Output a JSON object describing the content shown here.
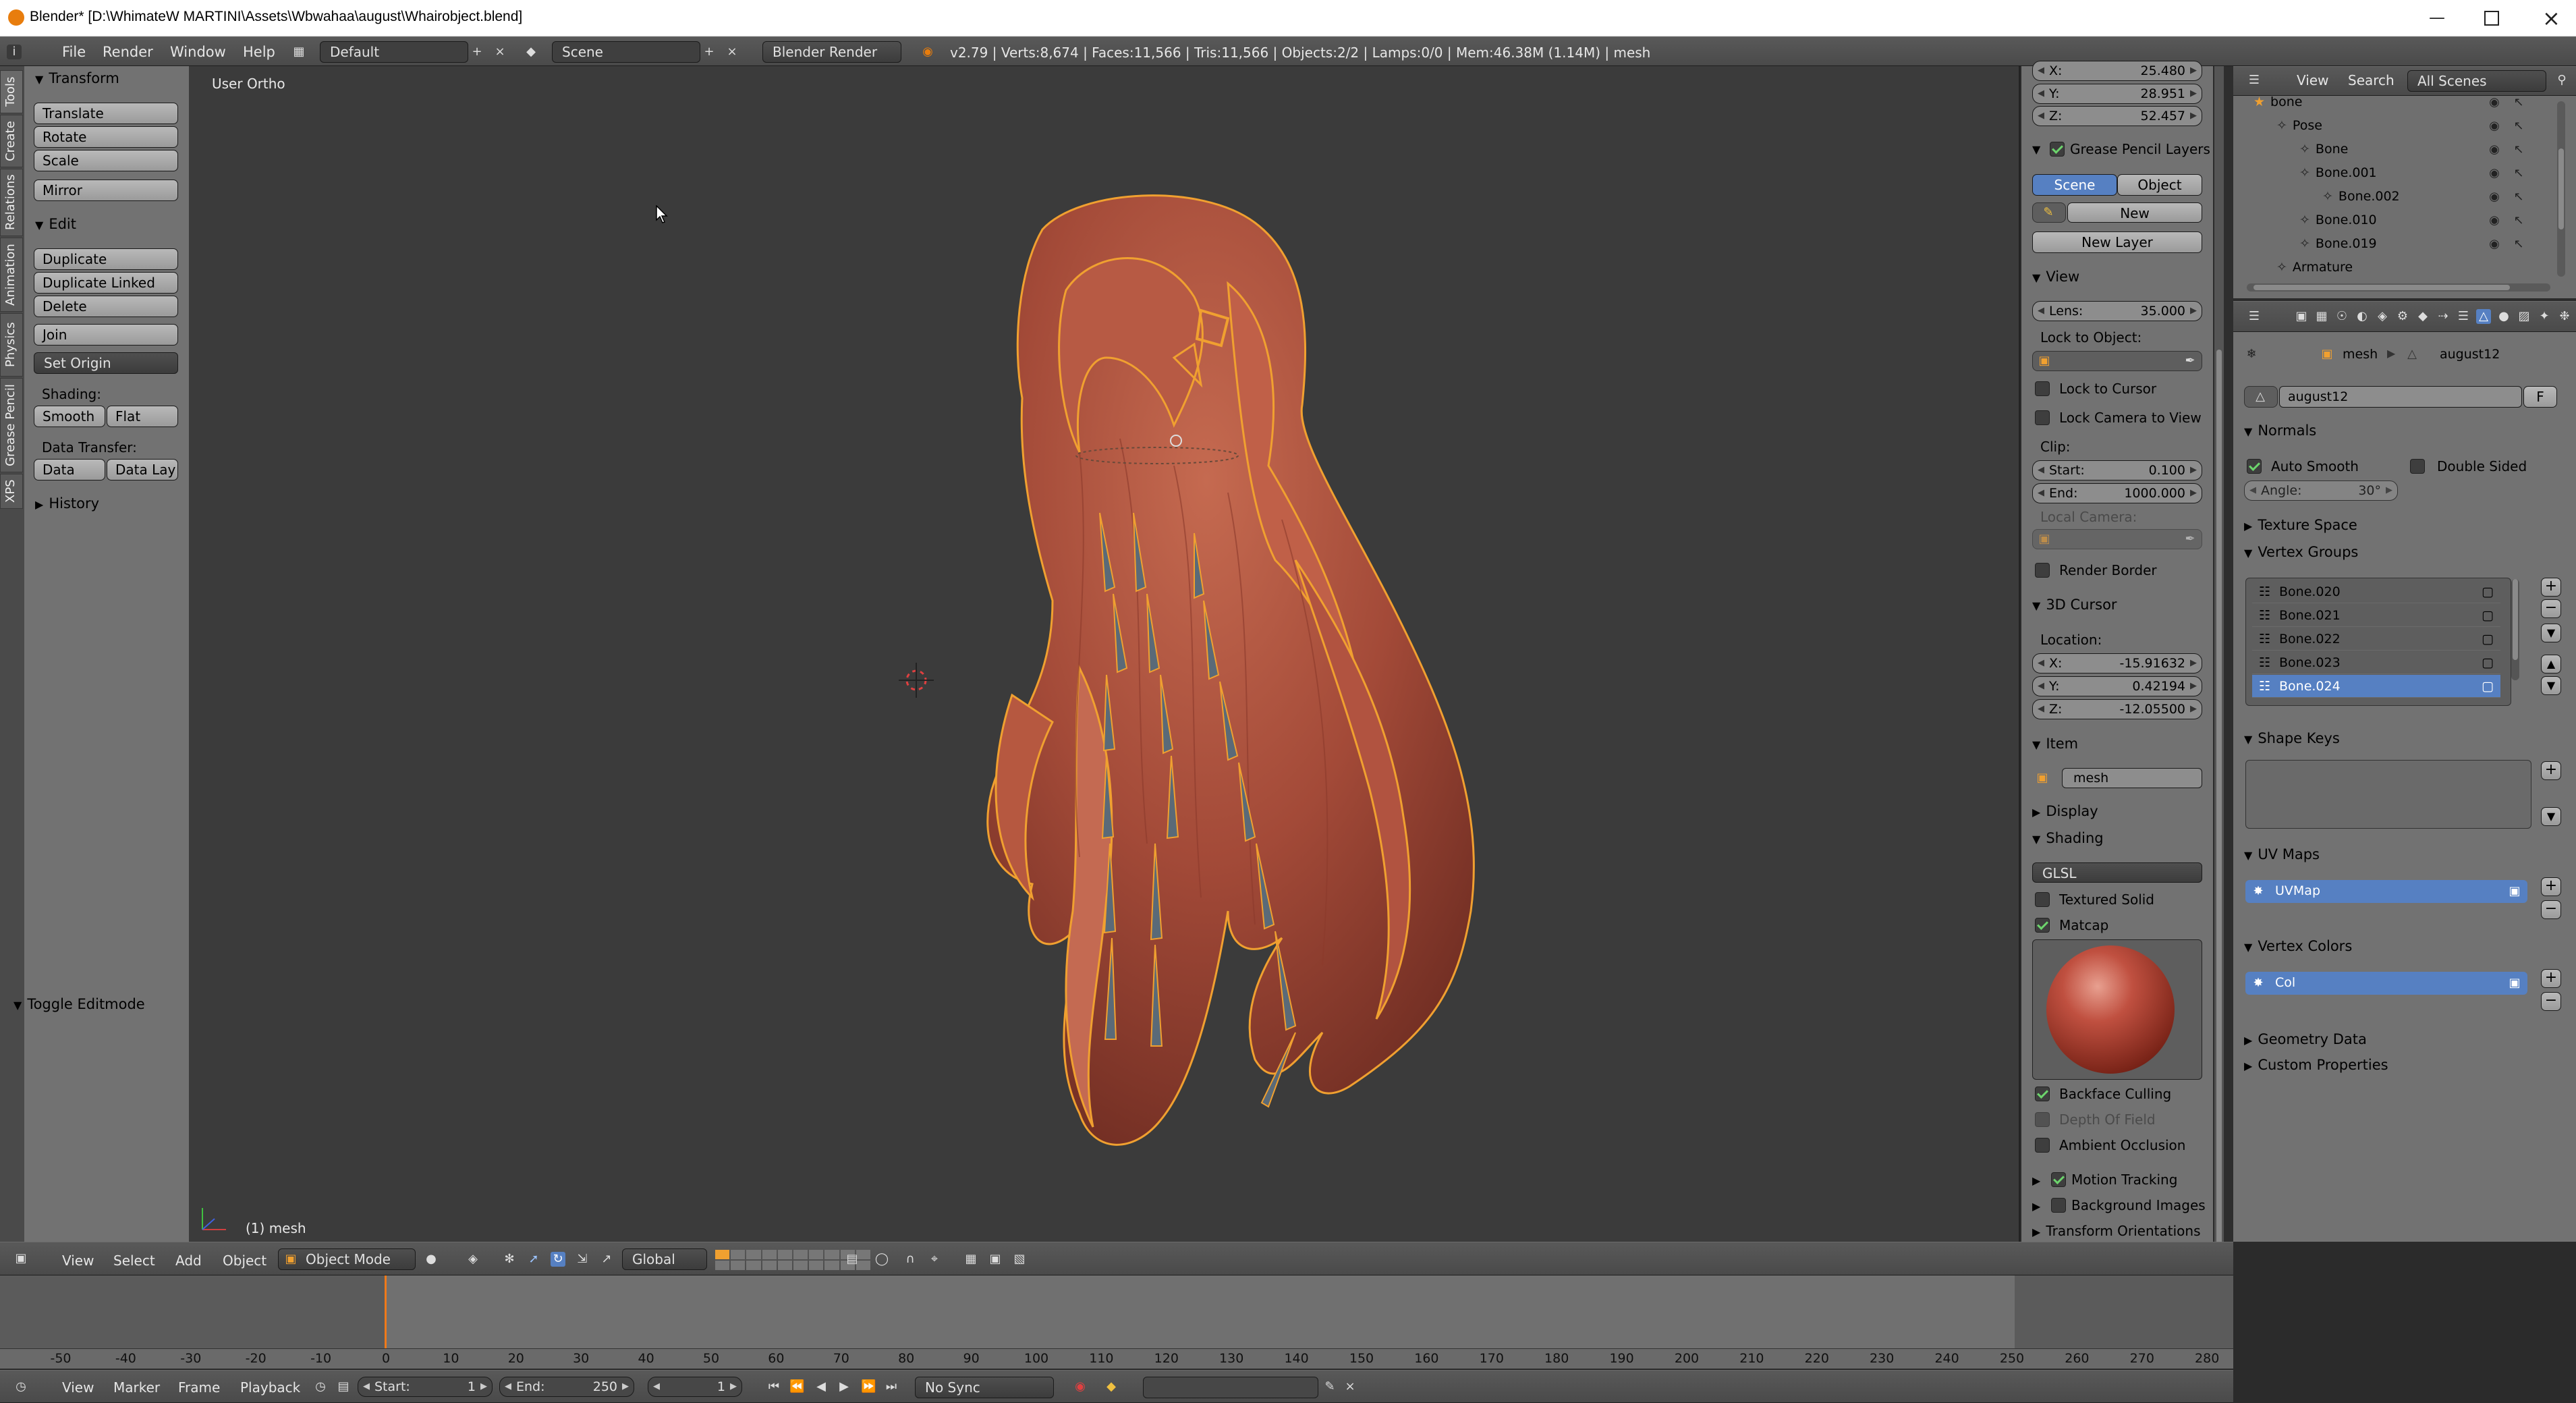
{
  "titlebar": {
    "title": "Blender* [D:\\WhimateW MARTINI\\Assets\\Wbwahaa\\august\\Whairobject.blend]"
  },
  "info_header": {
    "menus": [
      "File",
      "Render",
      "Window",
      "Help"
    ],
    "screen_layout": "Default",
    "scene": "Scene",
    "render_engine": "Blender Render",
    "stats": "v2.79 | Verts:8,674 | Faces:11,566 | Tris:11,566 | Objects:2/2 | Lamps:0/0 | Mem:46.38M (1.14M) | mesh"
  },
  "tool_shelf": {
    "tabs": [
      "Tools",
      "Create",
      "Relations",
      "Animation",
      "Physics",
      "Grease Pencil",
      "XPS"
    ],
    "transform_header": "Transform",
    "transform_buttons": [
      "Translate",
      "Rotate",
      "Scale",
      "Mirror"
    ],
    "edit_header": "Edit",
    "edit_buttons": [
      "Duplicate",
      "Duplicate Linked",
      "Delete",
      "Join"
    ],
    "set_origin": "Set Origin",
    "shading_label": "Shading:",
    "smooth": "Smooth",
    "flat": "Flat",
    "data_transfer_label": "Data Transfer:",
    "data": "Data",
    "data_lay": "Data Lay",
    "history": "History",
    "toggle_editmode": "Toggle Editmode"
  },
  "viewport": {
    "view_name": "User Ortho",
    "object_label": "(1) mesh"
  },
  "properties_n": {
    "loc_x_label": "X:",
    "loc_x": "25.480",
    "loc_y_label": "Y:",
    "loc_y": "28.951",
    "loc_z_label": "Z:",
    "loc_z": "52.457",
    "gp_header": "Grease Pencil Layers",
    "gp_scene": "Scene",
    "gp_object": "Object",
    "gp_new": "New",
    "gp_new_layer": "New Layer",
    "view_header": "View",
    "lens_label": "Lens:",
    "lens": "35.000",
    "lock_to_object": "Lock to Object:",
    "lock_to_cursor": "Lock to Cursor",
    "lock_camera": "Lock Camera to View",
    "clip": "Clip:",
    "clip_start_label": "Start:",
    "clip_start": "0.100",
    "clip_end_label": "End:",
    "clip_end": "1000.000",
    "local_camera": "Local Camera:",
    "render_border": "Render Border",
    "cursor_header": "3D Cursor",
    "location": "Location:",
    "cur_x_label": "X:",
    "cur_x": "-15.91632",
    "cur_y_label": "Y:",
    "cur_y": "0.42194",
    "cur_z_label": "Z:",
    "cur_z": "-12.05500",
    "item_header": "Item",
    "item_name": "mesh",
    "display_header": "Display",
    "shading_header": "Shading",
    "shading_mode": "GLSL",
    "textured_solid": "Textured Solid",
    "matcap": "Matcap",
    "backface_culling": "Backface Culling",
    "depth_of_field": "Depth Of Field",
    "ambient_occlusion": "Ambient Occlusion",
    "motion_tracking": "Motion Tracking",
    "background_images": "Background Images",
    "transform_orientations": "Transform Orientations"
  },
  "outliner": {
    "menus": [
      "View",
      "Search"
    ],
    "filter": "All Scenes",
    "rows": [
      {
        "label": "bone",
        "indent": 0
      },
      {
        "label": "Pose",
        "indent": 1
      },
      {
        "label": "Bone",
        "indent": 2
      },
      {
        "label": "Bone.001",
        "indent": 2
      },
      {
        "label": "Bone.002",
        "indent": 3
      },
      {
        "label": "Bone.010",
        "indent": 2
      },
      {
        "label": "Bone.019",
        "indent": 2
      },
      {
        "label": "Armature",
        "indent": 1
      }
    ]
  },
  "properties": {
    "breadcrumb_mesh": "mesh",
    "breadcrumb_data": "august12",
    "datablock_name": "august12",
    "datablock_fake": "F",
    "normals_header": "Normals",
    "auto_smooth": "Auto Smooth",
    "double_sided": "Double Sided",
    "angle_label": "Angle:",
    "angle": "30°",
    "texture_space": "Texture Space",
    "vertex_groups_header": "Vertex Groups",
    "vertex_groups": [
      "Bone.020",
      "Bone.021",
      "Bone.022",
      "Bone.023",
      "Bone.024"
    ],
    "shape_keys": "Shape Keys",
    "uv_maps": "UV Maps",
    "uv_map_name": "UVMap",
    "vertex_colors": "Vertex Colors",
    "vertex_color_name": "Col",
    "geometry_data": "Geometry Data",
    "custom_properties": "Custom Properties"
  },
  "view3d_header": {
    "menus": [
      "View",
      "Select",
      "Add",
      "Object"
    ],
    "mode": "Object Mode",
    "orientation": "Global"
  },
  "timeline": {
    "ticks": [
      "-50",
      "-40",
      "-30",
      "-20",
      "-10",
      "0",
      "10",
      "20",
      "30",
      "40",
      "50",
      "60",
      "70",
      "80",
      "90",
      "100",
      "110",
      "120",
      "130",
      "140",
      "150",
      "160",
      "170",
      "180",
      "190",
      "200",
      "210",
      "220",
      "230",
      "240",
      "250",
      "260",
      "270",
      "280"
    ],
    "menus": [
      "View",
      "Marker",
      "Frame",
      "Playback"
    ],
    "start_label": "Start:",
    "start": "1",
    "end_label": "End:",
    "end": "250",
    "current": "1",
    "sync": "No Sync"
  },
  "colors": {
    "accent_blue": "#5680c2",
    "selection_orange": "#f0a030",
    "hair": "#a04a38",
    "checkbox_green": "#6cd46c"
  }
}
